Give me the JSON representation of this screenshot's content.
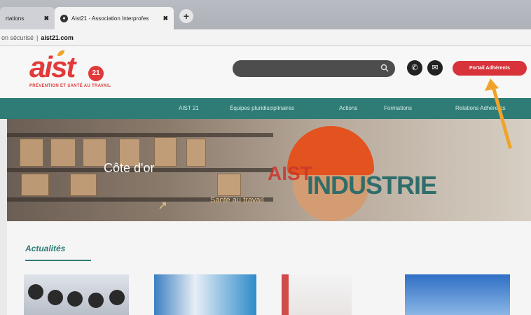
{
  "browser": {
    "tabs": [
      {
        "label": "rtations",
        "active": false
      },
      {
        "label": "Aist21 - Association Interprofes",
        "active": true
      }
    ],
    "close_glyph": "✖",
    "new_tab_glyph": "+",
    "address": {
      "security_text": "on sécurisé",
      "separator": "|",
      "domain": "aist21.com"
    }
  },
  "site": {
    "logo": {
      "word": "aist",
      "badge": "21",
      "tagline": "PRÉVENTION ET SANTÉ AU TRAVAIL"
    },
    "search": {
      "placeholder": "",
      "icon": "search-icon"
    },
    "phone_icon": "phone-icon",
    "mail_icon": "mail-icon",
    "cta_label": "Portail Adhérents",
    "nav": [
      "AIST 21",
      "Équipes pluridisciplinaires",
      "Actions",
      "Formations",
      "Relations Adhérents"
    ],
    "hero": {
      "title": "Côte d'or",
      "headline": "INDUSTRIE",
      "overlay_text": "AIST",
      "subtitle": "Santé au travail"
    },
    "news": {
      "title": "Actualités"
    }
  },
  "colors": {
    "brand_red": "#d8333a",
    "teal": "#2f7c76",
    "orange_arrow": "#f0a32b"
  }
}
